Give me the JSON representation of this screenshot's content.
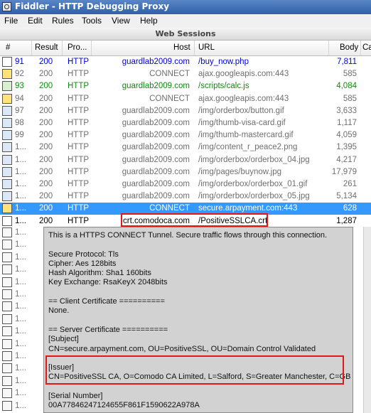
{
  "window": {
    "title": "Fiddler - HTTP Debugging Proxy"
  },
  "menu": [
    "File",
    "Edit",
    "Rules",
    "Tools",
    "View",
    "Help"
  ],
  "pane_title": "Web Sessions",
  "columns": [
    "#",
    "Result",
    "Pro...",
    "Host",
    "URL",
    "Body",
    "Ca"
  ],
  "sessions": [
    {
      "num": "91",
      "result": "200",
      "protocol": "HTTP",
      "host": "guardlab2009.com",
      "url": "/buy_now.php",
      "body": "7,811",
      "style": "blue",
      "icon": "doc"
    },
    {
      "num": "92",
      "result": "200",
      "protocol": "HTTP",
      "host": "CONNECT",
      "url": "ajax.googleapis.com:443",
      "body": "585",
      "style": "gray",
      "icon": "lock"
    },
    {
      "num": "93",
      "result": "200",
      "protocol": "HTTP",
      "host": "guardlab2009.com",
      "url": "/scripts/calc.js",
      "body": "4,084",
      "style": "green",
      "icon": "script"
    },
    {
      "num": "94",
      "result": "200",
      "protocol": "HTTP",
      "host": "CONNECT",
      "url": "ajax.googleapis.com:443",
      "body": "585",
      "style": "gray",
      "icon": "lock"
    },
    {
      "num": "97",
      "result": "200",
      "protocol": "HTTP",
      "host": "guardlab2009.com",
      "url": "/img/orderbox/button.gif",
      "body": "3,633",
      "style": "gray",
      "icon": "img"
    },
    {
      "num": "98",
      "result": "200",
      "protocol": "HTTP",
      "host": "guardlab2009.com",
      "url": "/img/thumb-visa-card.gif",
      "body": "1,117",
      "style": "gray",
      "icon": "img"
    },
    {
      "num": "99",
      "result": "200",
      "protocol": "HTTP",
      "host": "guardlab2009.com",
      "url": "/img/thumb-mastercard.gif",
      "body": "4,059",
      "style": "gray",
      "icon": "img"
    },
    {
      "num": "1...",
      "result": "200",
      "protocol": "HTTP",
      "host": "guardlab2009.com",
      "url": "/img/content_r_peace2.png",
      "body": "1,395",
      "style": "gray",
      "icon": "img"
    },
    {
      "num": "1...",
      "result": "200",
      "protocol": "HTTP",
      "host": "guardlab2009.com",
      "url": "/img/orderbox/orderbox_04.jpg",
      "body": "4,217",
      "style": "gray",
      "icon": "img"
    },
    {
      "num": "1...",
      "result": "200",
      "protocol": "HTTP",
      "host": "guardlab2009.com",
      "url": "/img/pages/buynow.jpg",
      "body": "17,979",
      "style": "gray",
      "icon": "img"
    },
    {
      "num": "1...",
      "result": "200",
      "protocol": "HTTP",
      "host": "guardlab2009.com",
      "url": "/img/orderbox/orderbox_01.gif",
      "body": "261",
      "style": "gray",
      "icon": "img"
    },
    {
      "num": "1...",
      "result": "200",
      "protocol": "HTTP",
      "host": "guardlab2009.com",
      "url": "/img/orderbox/orderbox_05.jpg",
      "body": "5,134",
      "style": "gray",
      "icon": "img"
    },
    {
      "num": "1...",
      "result": "200",
      "protocol": "HTTP",
      "host": "CONNECT",
      "url": "secure.arpayment.com:443",
      "body": "628",
      "style": "selected",
      "icon": "lock"
    },
    {
      "num": "1...",
      "result": "200",
      "protocol": "HTTP",
      "host": "crt.comodoca.com",
      "url": "/PositiveSSLCA.crt",
      "body": "1,287",
      "style": "black",
      "icon": "doc"
    }
  ],
  "obscured_rows": [
    "1...",
    "1...",
    "1...",
    "1...",
    "1...",
    "1...",
    "1...",
    "1...",
    "1...",
    "1...",
    "1...",
    "1...",
    "1...",
    "1...",
    "1..."
  ],
  "tooltip_lines": [
    "This is a HTTPS CONNECT Tunnel.  Secure traffic flows through this connection.",
    "",
    "Secure Protocol: Tls",
    "Cipher: Aes 128bits",
    "Hash Algorithm: Sha1 160bits",
    "Key Exchange: RsaKeyX 2048bits",
    "",
    "== Client Certificate ==========",
    "None.",
    "",
    "== Server Certificate ==========",
    "[Subject]",
    "  CN=secure.arpayment.com, OU=PositiveSSL, OU=Domain Control Validated",
    "",
    "[Issuer]",
    "  CN=PositiveSSL CA, O=Comodo CA Limited, L=Salford, S=Greater Manchester, C=GB",
    "",
    "[Serial Number]",
    "  00A77846247124655F861F1590622A978A"
  ],
  "colors": {
    "selection": "#3399ff",
    "green_text": "#118811",
    "blue_text": "#0000dd",
    "gray_text": "#6f6f6f",
    "highlight_box": "#e01818"
  }
}
